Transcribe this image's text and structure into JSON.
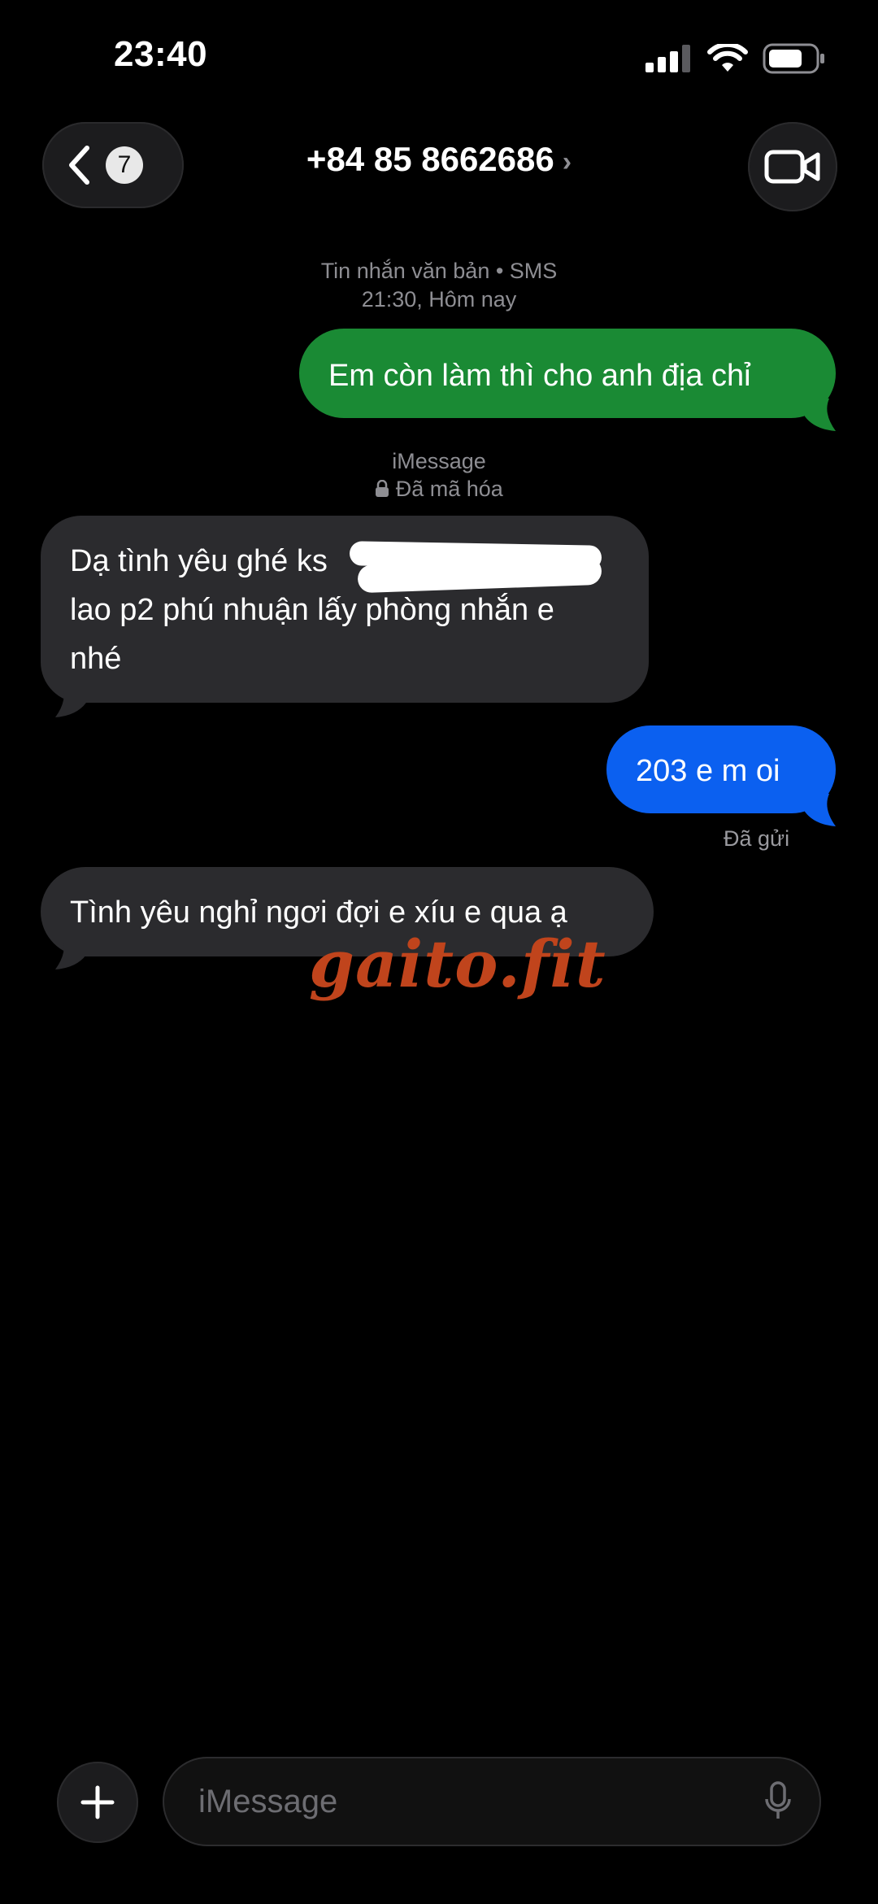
{
  "status_bar": {
    "time": "23:40"
  },
  "header": {
    "back_count": "7",
    "contact": "+84 85 8662686",
    "chevron": "›"
  },
  "sms_info": {
    "line1": "Tin nhắn văn bản • SMS",
    "line2": "21:30, Hôm nay"
  },
  "imessage_info": {
    "line1": "iMessage",
    "line2": "Đã mã hóa"
  },
  "messages": [
    {
      "text": "Em còn làm thì cho anh địa chỉ"
    },
    {
      "lines": [
        "Dạ tình yêu ghé ks",
        "lao p2 phú nhuận lấy phòng nhắn e",
        "nhé"
      ]
    },
    {
      "text": "203 e m oi"
    },
    {
      "text": "Tình yêu nghỉ ngơi đợi e xíu e qua ạ"
    }
  ],
  "delivered_label": "Đã gửi",
  "watermark": "gaito.fit",
  "composer": {
    "placeholder": "iMessage"
  }
}
